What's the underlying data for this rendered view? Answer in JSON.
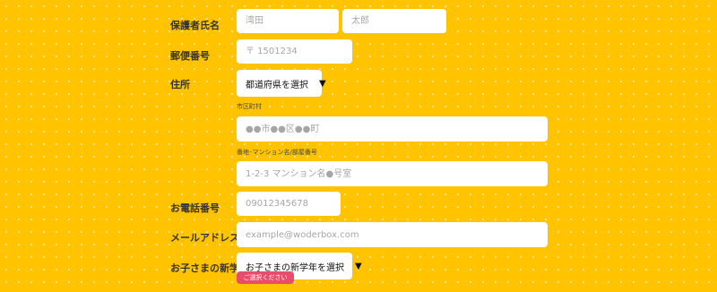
{
  "form": {
    "guardian_name": {
      "label": "保護者氏名",
      "last_placeholder": "湾田",
      "first_placeholder": "太郎"
    },
    "postal_code": {
      "label": "郵便番号",
      "placeholder": "〒 1501234"
    },
    "address": {
      "label": "住所",
      "prefecture_select": "都道府県を選択",
      "city_label": "市区町村",
      "city_placeholder": "●●市●●区●●町",
      "street_label": "番地･マンション名/部屋番号",
      "street_placeholder": "1-2-3 マンション名●号室"
    },
    "phone": {
      "label": "お電話番号",
      "placeholder": "09012345678"
    },
    "email": {
      "label": "メールアドレス",
      "placeholder": "example@woderbox.com"
    },
    "child_grade": {
      "label": "お子さまの新学年",
      "select": "お子さまの新学年を選択",
      "error": "ご選択ください"
    }
  },
  "icons": {
    "dropdown": "caret-down-icon"
  },
  "colors": {
    "background": "#ffc300",
    "error": "#e84d6b"
  }
}
